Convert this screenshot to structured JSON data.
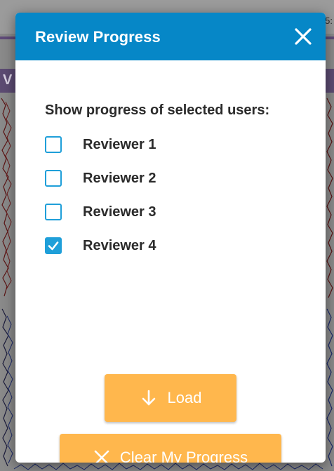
{
  "background": {
    "clock_fragment": "5:",
    "purple_fragment": "V"
  },
  "dialog": {
    "title": "Review Progress",
    "close_icon": "close-icon",
    "section_label": "Show progress of selected users:",
    "reviewers": [
      {
        "label": "Reviewer 1",
        "checked": false
      },
      {
        "label": "Reviewer 2",
        "checked": false
      },
      {
        "label": "Reviewer 3",
        "checked": false
      },
      {
        "label": "Reviewer 4",
        "checked": true
      }
    ],
    "load_button": {
      "label": "Load",
      "icon": "arrow-down-icon"
    },
    "clear_button": {
      "label": "Clear My Progress",
      "icon": "close-icon"
    }
  },
  "colors": {
    "header": "#0687c7",
    "checkbox": "#1f9fd9",
    "button": "#ffb74d",
    "text": "#2b2b2b"
  }
}
